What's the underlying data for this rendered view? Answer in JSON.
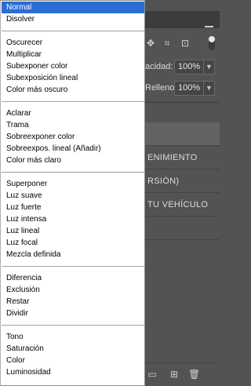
{
  "blend_modes": {
    "groups": [
      [
        "Normal",
        "Disolver"
      ],
      [
        "Oscurecer",
        "Multiplicar",
        "Subexponer color",
        "Subexposición lineal",
        "Color más oscuro"
      ],
      [
        "Aclarar",
        "Trama",
        "Sobreexponer color",
        "Sobreexpos. lineal (Añadir)",
        "Color más claro"
      ],
      [
        "Superponer",
        "Luz suave",
        "Luz fuerte",
        "Luz intensa",
        "Luz lineal",
        "Luz focal",
        "Mezcla definida"
      ],
      [
        "Diferencia",
        "Exclusión",
        "Restar",
        "Dividir"
      ],
      [
        "Tono",
        "Saturación",
        "Color",
        "Luminosidad"
      ]
    ],
    "selected": "Normal"
  },
  "layers_panel": {
    "opacity_label": "acidad:",
    "opacity_value": "100%",
    "fill_label": "Relleno:",
    "fill_value": "100%",
    "layers": [
      "ENIMIENTO",
      "RSIÓN)",
      "TU VEHÍCULO"
    ]
  },
  "colors": {
    "selection": "#2b6dd4",
    "panel_bg": "#535353"
  }
}
